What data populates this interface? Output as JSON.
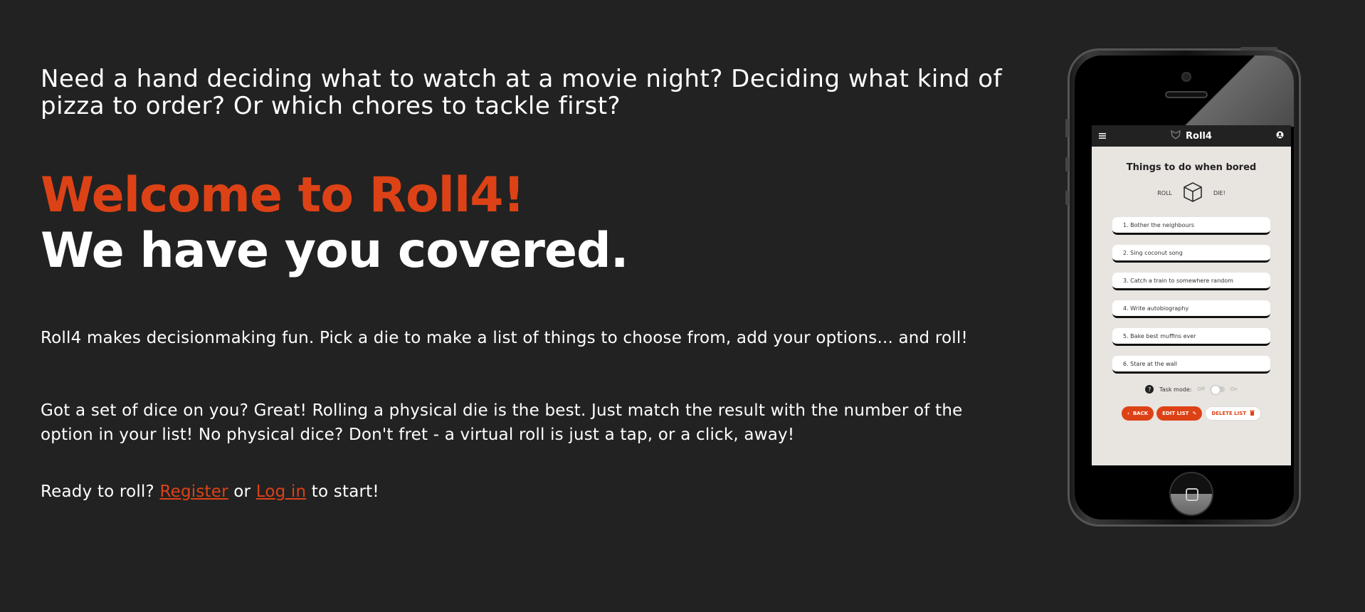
{
  "intro": "Need a hand deciding what to watch at a movie night? Deciding what kind of pizza to order? Or which chores to tackle first?",
  "hero": {
    "welcome": "Welcome to Roll4!",
    "covered": "We have you covered."
  },
  "paragraphs": {
    "p1": "Roll4 makes decisionmaking fun. Pick a die to make a list of things to choose from, add your options... and roll!",
    "p2": "Got a set of dice on you? Great! Rolling a physical die is the best. Just match the result with the number of the option in your list! No physical dice? Don't fret - a virtual roll is just a tap, or a click, away!",
    "p3_before": "Ready to roll?",
    "register": "Register",
    "or": "or",
    "login": "Log in",
    "p3_after": "to start!"
  },
  "phone_app": {
    "brand": "Roll4",
    "list_title": "Things to do when bored",
    "roll_left": "ROLL",
    "roll_right": "DIE!",
    "items": [
      "1. Bother the neighbours",
      "2. Sing coconut song",
      "3. Catch a train to somewhere random",
      "4. Write autobiography",
      "5. Bake best muffins ever",
      "6. Stare at the wall"
    ],
    "task_mode": "Task mode:",
    "off": "Off",
    "on": "On",
    "back": "BACK",
    "edit": "EDIT LIST",
    "delete": "DELETE LIST"
  },
  "colors": {
    "accent": "#dd4216",
    "background": "#222222"
  }
}
